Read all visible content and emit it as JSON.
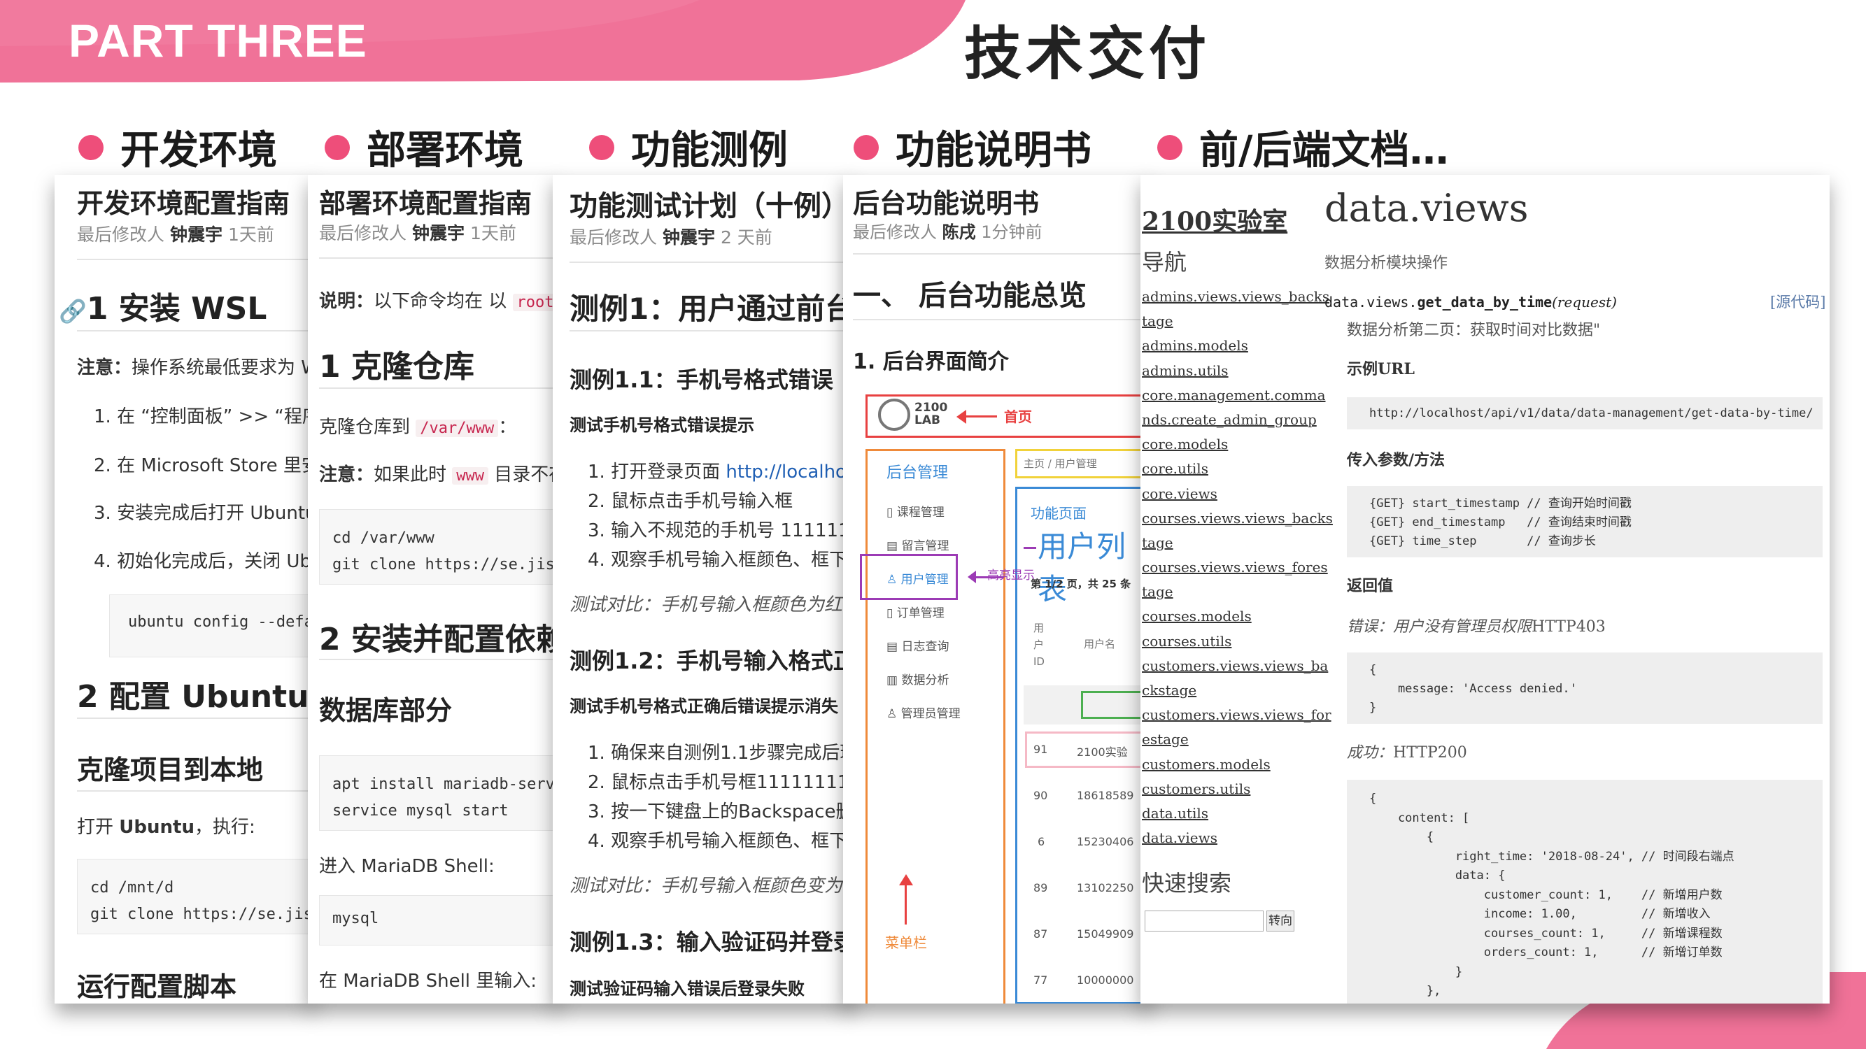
{
  "header": {
    "part": "PART THREE",
    "title": "技术交付"
  },
  "categories": [
    "开发环境",
    "部署环境",
    "功能测例",
    "功能说明书",
    "前/后端文档…"
  ],
  "colors": {
    "accent": "#ee4e7a",
    "link": "#1f5fb4"
  },
  "card1": {
    "title": "开发环境配置指南",
    "meta_prefix": "最后修改人",
    "author": "钟震宇",
    "time": "1天前",
    "h_wsl": "1 安装 WSL",
    "note_label": "注意：",
    "note": "操作系统最低要求为 W",
    "steps": [
      "1. 在 “控制面板” >> “程序和",
      "2. 在 Microsoft Store 里安装",
      "3. 安装完成后打开 Ubuntu",
      "4. 初始化完成后，关闭 Ubu"
    ],
    "code1": "ubuntu config --defa",
    "h_ubuntu": "2 配置 Ubuntu 系",
    "h_clone": "克隆项目到本地",
    "open_text": "打开 ",
    "open_bold": "Ubuntu",
    "open_tail": "，执行:",
    "code2": "cd /mnt/d\ngit clone https://se.jis",
    "h_run": "运行配置脚本"
  },
  "card2": {
    "title": "部署环境配置指南",
    "meta_prefix": "最后修改人",
    "author": "钟震宇",
    "time": "1天前",
    "desc_label": "说明：",
    "desc": "以下命令均在 以 ",
    "desc_code": "root",
    "h_clone": "1 克隆仓库",
    "clone_text": "克隆仓库到 ",
    "clone_code": "/var/www",
    "clone_tail": "：",
    "note_label": "注意：",
    "note": "如果此时 ",
    "note_code": "www",
    "note_tail": " 目录不存",
    "code1": "cd /var/www\ngit clone https://se.jisu",
    "h_deps": "2 安装并配置依赖",
    "h_db": "数据库部分",
    "code2": "apt install mariadb-serv\nservice mysql start",
    "enter_shell": "进入 MariaDB Shell:",
    "code3": "mysql",
    "shell_input": "在 MariaDB Shell 里输入:"
  },
  "card3": {
    "title": "功能测试计划（十例）",
    "meta_prefix": "最后修改人",
    "author": "钟震宇",
    "time": "2 天前",
    "case1": "测例1：用户通过前台",
    "case11": "测例1.1：手机号格式错误",
    "case11_sub": "测试手机号格式错误提示",
    "case11_steps": [
      "1. 打开登录页面 ",
      "2. 鼠标点击手机号输入框",
      "3. 输入不规范的手机号 1111111",
      "4. 观察手机号输入框颜色、框下方"
    ],
    "case11_link": "http://localhost/",
    "case11_compare": "测试对比：手机号输入框颜色为红",
    "case12": "测例1.2：手机号输入格式正",
    "case12_sub": "测试手机号格式正确后错误提示消失",
    "case12_steps": [
      "1. 确保来自测例1.1步骤完成后环",
      "2. 鼠标点击手机号框1111111111",
      "3. 按一下键盘上的Backspace删除",
      "4. 观察手机号输入框颜色、框下方"
    ],
    "case12_compare": "测试对比：手机号输入框颜色变为",
    "case13": "测例1.3：输入验证码并登录",
    "case13_sub": "测试验证码输入错误后登录失败"
  },
  "card4": {
    "title": "后台功能说明书",
    "meta_prefix": "最后修改人",
    "author": "陈戌",
    "time": "1分钟前",
    "section": "一、 后台功能总览",
    "sub": "1. 后台界面简介",
    "shot": {
      "logo": "2100\nLAB",
      "home_label": "首页",
      "sidebar_title": "后台管理",
      "menu": [
        "课程管理",
        "留言管理",
        "用户管理",
        "订单管理",
        "日志查询",
        "数据分析",
        "管理员管理"
      ],
      "breadcrumb": "主页 / 用户管理",
      "page_label": "功能页面",
      "list_title": "用户列表",
      "highlight_label": "高亮显示",
      "pager": "第 1/2 页，共 25 条",
      "col1": "用户ID",
      "col2": "用户名",
      "rows": [
        [
          "91",
          "2100实验"
        ],
        [
          "90",
          "18618589"
        ],
        [
          "6",
          "15230406"
        ],
        [
          "89",
          "13102250"
        ],
        [
          "87",
          "15049909"
        ],
        [
          "77",
          "10000000"
        ]
      ],
      "menu_bar": "菜单栏"
    }
  },
  "card5": {
    "site": "2100实验室",
    "nav_title": "导航",
    "nav_links": [
      "admins.views.views_backs",
      "tage",
      "admins.models",
      "admins.utils",
      "core.management.comma",
      "nds.create_admin_group",
      "core.models",
      "core.utils",
      "core.views",
      "courses.views.views_backs",
      "tage",
      "courses.views.views_fores",
      "tage",
      "courses.models",
      "courses.utils",
      "customers.views.views_ba",
      "ckstage",
      "customers.views.views_for",
      "estage",
      "customers.models",
      "customers.utils",
      "data.utils",
      "data.views"
    ],
    "search_title": "快速搜索",
    "search_button": "转向",
    "module": "data.views",
    "module_desc": "数据分析模块操作",
    "func_prefix": "data.views.",
    "func_name": "get_data_by_time",
    "func_arg": "(request)",
    "source": "[源代码]",
    "func_desc": "数据分析第二页：获取时间对比数据\"",
    "url_label": "示例URL",
    "url": "http://localhost/api/v1/data/data-management/get-data-by-time/",
    "params_label": "传入参数/方法",
    "params": [
      "{GET} start_timestamp // 查询开始时间戳",
      "{GET} end_timestamp   // 查询结束时间戳",
      "{GET} time_step       // 查询步长"
    ],
    "return_label": "返回值",
    "error_label": "错误：",
    "error_text": "用户没有管理员权限",
    "error_code": "HTTP403",
    "error_json": "{\n    message: 'Access denied.'\n}",
    "ok_label": "成功：",
    "ok_code": "HTTP200",
    "ok_json": "{\n    content: [\n        {\n            right_time: '2018-08-24', // 时间段右端点\n            data: {\n                customer_count: 1,    // 新增用户数\n                income: 1.00,         // 新增收入\n                courses_count: 1,     // 新增课程数\n                orders_count: 1,      // 新增订单数\n            }\n        },"
  }
}
